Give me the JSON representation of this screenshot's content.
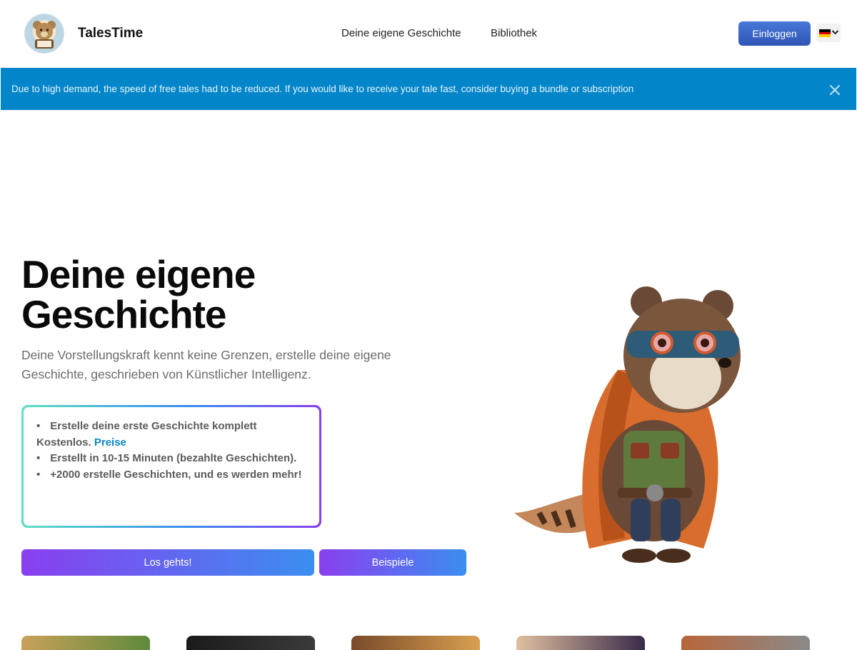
{
  "header": {
    "brand": "TalesTime",
    "nav": [
      "Deine eigene Geschichte",
      "Bibliothek"
    ],
    "login_label": "Einloggen",
    "language": "de"
  },
  "banner": {
    "text": "Due to high demand, the speed of free tales had to be reduced. If you would like to receive your tale fast, consider buying a bundle or subscription"
  },
  "hero": {
    "title_line1": "Deine eigene",
    "title_line2": "Geschichte",
    "subtitle": "Deine Vorstellungskraft kennt keine Grenzen, erstelle deine eigene Geschichte, geschrieben von Künstlicher Intelligenz.",
    "features": {
      "f1_text": "Erstelle deine erste Geschichte komplett Kostenlos.",
      "f1_link": "Preise",
      "f2": "Erstellt in 10-15 Minuten (bezahlte Geschichten).",
      "f3": "+2000 erstelle Geschichten, und es werden mehr!"
    },
    "primary_button": "Los gehts!",
    "secondary_button": "Beispiele"
  },
  "colors": {
    "banner": "#0386c9",
    "accent_purple": "#8a3ff0",
    "accent_blue": "#3b8ef0",
    "login": "#2f55b5"
  },
  "icons": [
    "bear-logo-icon",
    "german-flag-icon",
    "chevron-down-icon",
    "close-icon",
    "superhero-raccoon-illustration"
  ]
}
